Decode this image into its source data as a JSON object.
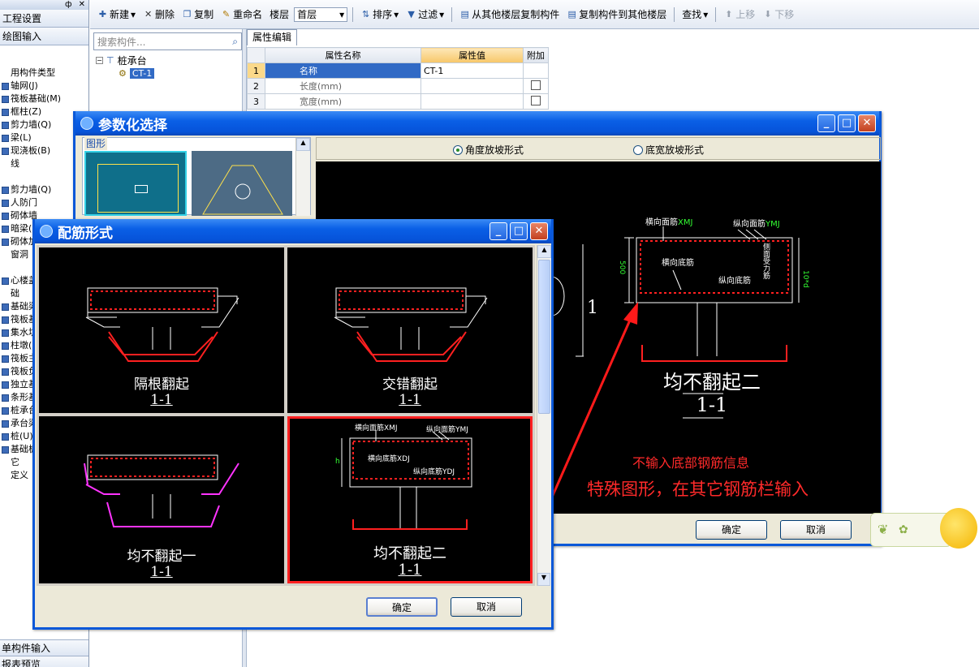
{
  "leftnav": {
    "pin": "ф",
    "close": "✕",
    "section_btns": [
      "工程设置",
      "绘图输入"
    ],
    "tree": [
      "用构件类型",
      "轴网(J)",
      "筏板基础(M)",
      "框柱(Z)",
      "剪力墙(Q)",
      "梁(L)",
      "现浇板(B)",
      "线",
      "",
      "剪力墙(Q)",
      "人防门",
      "砌体墙",
      "暗梁(",
      "砌体加",
      "窗洞",
      "",
      "心楼盖",
      "础",
      "基础梁",
      "筏板基",
      "集水坑",
      "柱墩(",
      "筏板主",
      "筏板负",
      "独立基",
      "条形基",
      "桩承台",
      "承台梁",
      "桩(U)",
      "基础板",
      "它",
      "定义"
    ],
    "bottom": [
      "单构件输入",
      "报表预览"
    ]
  },
  "toolbar": {
    "new": "新建",
    "delete": "删除",
    "copy": "复制",
    "rename": "重命名",
    "floor_label": "楼层",
    "floor_value": "首层",
    "sort": "排序",
    "filter": "过滤",
    "copy_from": "从其他楼层复制构件",
    "copy_to": "复制构件到其他楼层",
    "find": "查找",
    "up": "上移",
    "down": "下移"
  },
  "search": {
    "placeholder": "搜索构件..."
  },
  "tree": {
    "root": "桩承台",
    "child": "CT-1"
  },
  "prop": {
    "tab": "属性编辑",
    "headers": [
      "属性名称",
      "属性值",
      "附加"
    ],
    "rows": [
      {
        "n": "1",
        "name": "名称",
        "value": "CT-1"
      },
      {
        "n": "2",
        "name": "长度(mm)",
        "value": ""
      },
      {
        "n": "3",
        "name": "宽度(mm)",
        "value": ""
      }
    ]
  },
  "param_dialog": {
    "title": "参数化选择",
    "group": "图形",
    "radio1": "角度放坡形式",
    "radio2": "底宽放坡形式",
    "preview_caption": "均不翻起二",
    "preview_section": "1-1",
    "note1": "不输入底部钢筋信息",
    "note2": "特殊图形，在其它钢筋栏输入",
    "ok": "确定",
    "cancel": "取消",
    "labels": {
      "hxmj": "横向面筋",
      "hxmj2": "XMJ",
      "zxmj": "纵向面筋",
      "zxmj2": "YMJ",
      "hxdj": "横向底筋",
      "zxdj": "纵向底筋",
      "side": "侧面受力筋",
      "dim500": "500",
      "num1": "1",
      "num10d": "10*d"
    }
  },
  "rebar_dialog": {
    "title": "配筋形式",
    "options": [
      {
        "name": "隔根翻起",
        "section": "1-1"
      },
      {
        "name": "交错翻起",
        "section": "1-1"
      },
      {
        "name": "均不翻起一",
        "section": "1-1"
      },
      {
        "name": "均不翻起二",
        "section": "1-1"
      }
    ],
    "labels": {
      "hxmj": "横向面筋XMJ",
      "zxmj": "纵向面筋YMJ",
      "hxdj": "横向底筋XDJ",
      "zxdj": "纵向底筋YDJ",
      "h": "h"
    },
    "ok": "确定",
    "cancel": "取消"
  },
  "colors": {
    "accent": "#0a58d8",
    "selected": "#ff2020",
    "annotation": "#ff2a2a"
  }
}
